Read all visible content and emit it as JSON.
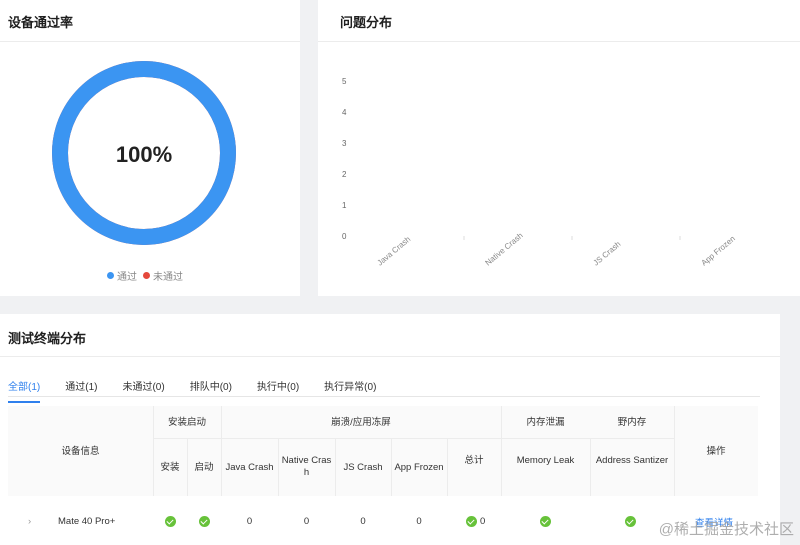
{
  "pass_panel": {
    "title": "设备通过率",
    "percent_text": "100%",
    "pass_fraction": 1.0,
    "legend": [
      {
        "label": "通过",
        "color": "#3b95f2"
      },
      {
        "label": "未通过",
        "color": "#e5483c"
      }
    ]
  },
  "issue_panel": {
    "title": "问题分布",
    "chart_data": {
      "type": "bar",
      "categories": [
        "Java Crash",
        "Native Crash",
        "JS Crash",
        "App Frozen"
      ],
      "values": [
        0,
        0,
        0,
        0
      ],
      "yticks": [
        "0",
        "1",
        "2",
        "3",
        "4",
        "5"
      ],
      "ylim": [
        0,
        5
      ]
    }
  },
  "term_panel": {
    "title": "测试终端分布",
    "tabs": [
      "全部(1)",
      "通过(1)",
      "未通过(0)",
      "排队中(0)",
      "执行中(0)",
      "执行异常(0)"
    ],
    "headers": {
      "device_info": "设备信息",
      "install_launch": "安装启动",
      "install": "安装",
      "launch": "启动",
      "crash_freeze": "崩溃/应用冻屏",
      "java_crash": "Java Crash",
      "native_crash_1": "Native Cras",
      "native_crash_2": "h",
      "js_crash": "JS Crash",
      "app_frozen": "App Frozen",
      "total": "总计",
      "memory_leak_group": "内存泄漏",
      "memory_leak": "Memory Leak",
      "wild_memory_group": "野内存",
      "address_sanitizer": "Address Santizer",
      "actions": "操作"
    },
    "row": {
      "device": "Mate 40 Pro+",
      "java_crash": "0",
      "native_crash": "0",
      "js_crash": "0",
      "app_frozen": "0",
      "total": "0",
      "action": "查看详情"
    }
  },
  "watermark": "@稀土掘金技术社区"
}
